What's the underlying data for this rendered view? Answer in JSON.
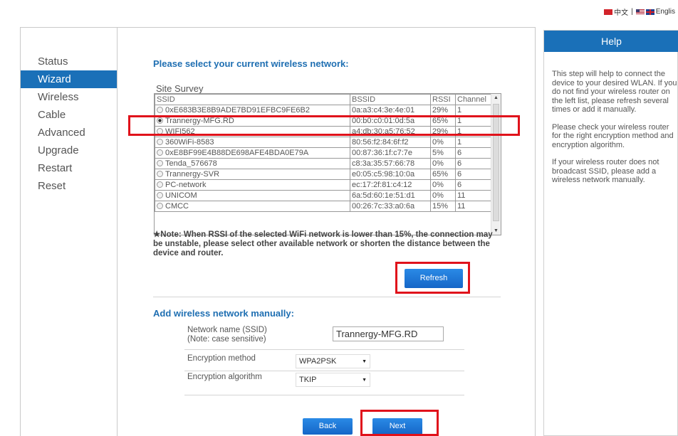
{
  "lang": {
    "chinese": "中文",
    "separator": "|",
    "english": "Englis"
  },
  "sidebar": {
    "items": [
      {
        "label": "Status"
      },
      {
        "label": "Wizard"
      },
      {
        "label": "Wireless"
      },
      {
        "label": "Cable"
      },
      {
        "label": "Advanced"
      },
      {
        "label": "Upgrade"
      },
      {
        "label": "Restart"
      },
      {
        "label": "Reset"
      }
    ],
    "active_index": 1
  },
  "wizard": {
    "select_title": "Please select your current wireless network:",
    "site_survey_label": "Site Survey",
    "columns": [
      "SSID",
      "BSSID",
      "RSSI",
      "Channel"
    ],
    "rows": [
      {
        "ssid": "0xE683B3E8B9ADE7BD91EFBC9FE6B2",
        "bssid": "0a:a3:c4:3e:4e:01",
        "rssi": "29%",
        "channel": "1",
        "selected": false
      },
      {
        "ssid": "Trannergy-MFG.RD",
        "bssid": "00:b0:c0:01:0d:5a",
        "rssi": "65%",
        "channel": "1",
        "selected": true
      },
      {
        "ssid": "WIFI562",
        "bssid": "a4:db:30:a5:76:52",
        "rssi": "29%",
        "channel": "1",
        "selected": false
      },
      {
        "ssid": "360WiFi-8583",
        "bssid": "80:56:f2:84:6f:f2",
        "rssi": "0%",
        "channel": "1",
        "selected": false
      },
      {
        "ssid": "0xE8BF99E4B88DE698AFE4BDA0E79A",
        "bssid": "00:87:36:1f:c7:7e",
        "rssi": "5%",
        "channel": "6",
        "selected": false
      },
      {
        "ssid": "Tenda_576678",
        "bssid": "c8:3a:35:57:66:78",
        "rssi": "0%",
        "channel": "6",
        "selected": false
      },
      {
        "ssid": "Trannergy-SVR",
        "bssid": "e0:05:c5:98:10:0a",
        "rssi": "65%",
        "channel": "6",
        "selected": false
      },
      {
        "ssid": "PC-network",
        "bssid": "ec:17:2f:81:c4:12",
        "rssi": "0%",
        "channel": "6",
        "selected": false
      },
      {
        "ssid": "UNICOM",
        "bssid": "6a:5d:60:1e:51:d1",
        "rssi": "0%",
        "channel": "11",
        "selected": false
      },
      {
        "ssid": "CMCC",
        "bssid": "00:26:7c:33:a0:6a",
        "rssi": "15%",
        "channel": "11",
        "selected": false
      }
    ],
    "note": "★Note: When RSSI of the selected WiFi network is lower than 15%, the connection may be unstable, please select other available network or shorten the distance between the device and router.",
    "refresh_label": "Refresh",
    "manual_title": "Add wireless network manually:",
    "ssid_label_line1": "Network name (SSID)",
    "ssid_label_line2": "(Note: case sensitive)",
    "ssid_value": "Trannergy-MFG.RD",
    "encryption_method_label": "Encryption method",
    "encryption_method_value": "WPA2PSK",
    "encryption_algorithm_label": "Encryption algorithm",
    "encryption_algorithm_value": "TKIP",
    "back_label": "Back",
    "next_label": "Next"
  },
  "help": {
    "title": "Help",
    "paragraphs": [
      "This step will help to connect the device to your desired WLAN. If you do not find your wireless router on the left list, please refresh several times or add it manually.",
      "Please check your wireless router for the right encryption method and encryption algorithm.",
      "If your wireless router does not broadcast SSID, please add a wireless network manually."
    ]
  },
  "colors": {
    "accent": "#1a70b8",
    "title_blue": "#1f6fb2",
    "highlight_red": "#e0121b"
  }
}
